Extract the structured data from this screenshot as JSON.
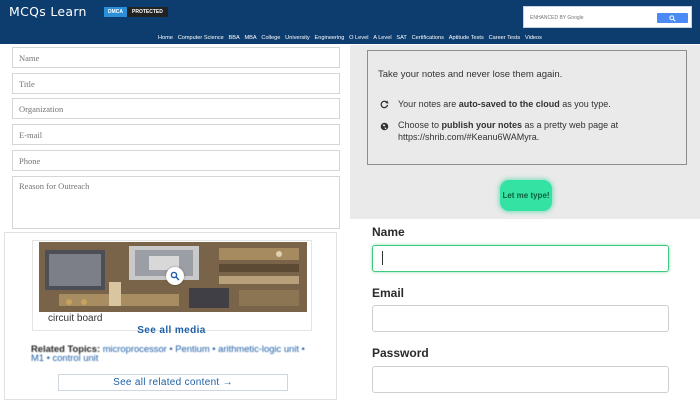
{
  "header": {
    "logo": "MCQs Learn",
    "badge_left": "DMCA",
    "badge_right": "PROTECTED",
    "search_placeholder": "ENHANCED BY Google",
    "search_icon": "search-icon",
    "nav": [
      "Home",
      "Computer Science",
      "BBA",
      "MBA",
      "College",
      "University",
      "Engineering",
      "O Level",
      "A Level",
      "SAT",
      "Certifications",
      "Aptitude Tests",
      "Career Tests",
      "Videos"
    ]
  },
  "contact_form": {
    "name_placeholder": "Name",
    "title_placeholder": "Title",
    "organization_placeholder": "Organization",
    "email_placeholder": "E-mail",
    "phone_placeholder": "Phone",
    "reason_placeholder": "Reason for Outreach"
  },
  "media": {
    "caption": "circuit board",
    "see_all_media": "See all media",
    "related_label": "Related Topics:",
    "related_topics": "microprocessor • Pentium • arithmetic-logic unit • M1 • control unit",
    "see_all_related": "See all related content →",
    "zoom_icon": "magnifier-icon"
  },
  "notes": {
    "intro": "Take your notes and never lose them again.",
    "autosave_pre": "Your notes are ",
    "autosave_bold": "auto-saved to the cloud",
    "autosave_post": " as you type.",
    "publish_pre": "Choose to ",
    "publish_bold": "publish your notes",
    "publish_post": " as a pretty web page at",
    "publish_url": "https://shrib.com/#Keanu6WAMyra.",
    "sync_icon": "refresh-icon",
    "globe_icon": "globe-icon",
    "button": "Let me type!",
    "button_color": "#34e3a3"
  },
  "signup": {
    "name_label": "Name",
    "email_label": "Email",
    "password_label": "Password",
    "focus_color": "#3ec97e"
  },
  "colors": {
    "header_bg": "#0d3d6e",
    "panel_gray": "#eaeaea",
    "link_blue": "#1e5fa8"
  }
}
